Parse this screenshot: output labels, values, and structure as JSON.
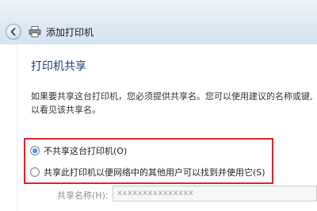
{
  "window": {
    "title": "添加打印机"
  },
  "page": {
    "heading": "打印机共享",
    "description_lines": [
      "如果要共享这台打印机，您必须提供共享名。您可以使用建议的名称或键入一",
      "以看见该共享名。"
    ]
  },
  "sharing_options": {
    "no_share_label": "不共享这台打印机(O)",
    "share_label": "共享此打印机以便网络中的其他用户可以找到并使用它(S)",
    "selected": "no_share"
  },
  "share_name": {
    "label": "共享名称(H):",
    "value": "xxxxxxxxxxxxxxx"
  },
  "colors": {
    "highlight_border": "#d9252a",
    "heading": "#1e3f7a"
  },
  "icons": {
    "back": "back-arrow-icon",
    "printer": "printer-icon"
  }
}
